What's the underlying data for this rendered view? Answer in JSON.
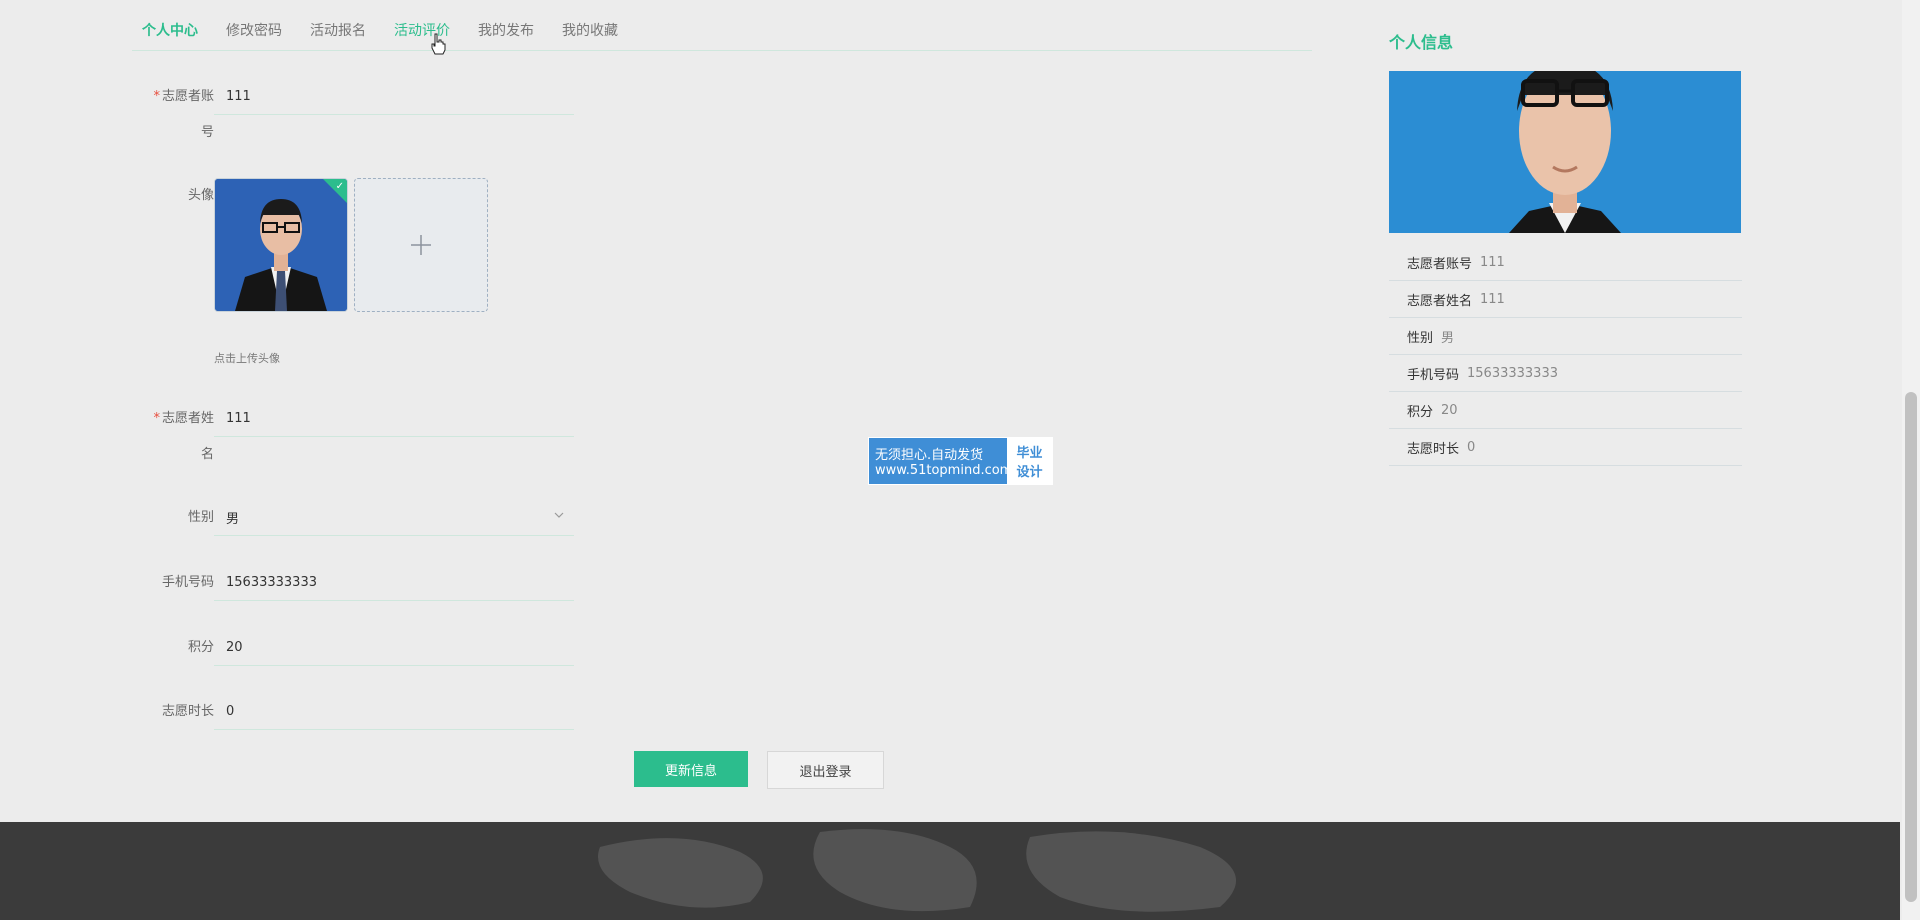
{
  "tabs": [
    {
      "label": "个人中心"
    },
    {
      "label": "修改密码"
    },
    {
      "label": "活动报名"
    },
    {
      "label": "活动评价"
    },
    {
      "label": "我的发布"
    },
    {
      "label": "我的收藏"
    }
  ],
  "form": {
    "account_label": "志愿者账号",
    "account_value": "111",
    "avatar_label": "头像",
    "upload_hint": "点击上传头像",
    "name_label": "志愿者姓名",
    "name_value": "111",
    "gender_label": "性别",
    "gender_value": "男",
    "phone_label": "手机号码",
    "phone_value": "15633333333",
    "points_label": "积分",
    "points_value": "20",
    "hours_label": "志愿时长",
    "hours_value": "0",
    "required_mark": "*"
  },
  "buttons": {
    "update": "更新信息",
    "logout": "退出登录"
  },
  "watermark": {
    "line1": "无须担心.自动发货",
    "line2": "www.51topmind.com",
    "right1": "毕业",
    "right2": "设计"
  },
  "profile": {
    "title": "个人信息",
    "rows": [
      {
        "label": "志愿者账号",
        "value": "111"
      },
      {
        "label": "志愿者姓名",
        "value": "111"
      },
      {
        "label": "性别",
        "value": "男"
      },
      {
        "label": "手机号码",
        "value": "15633333333"
      },
      {
        "label": "积分",
        "value": "20"
      },
      {
        "label": "志愿时长",
        "value": "0"
      }
    ]
  },
  "colors": {
    "accent": "#2cbd8d",
    "footer": "#3b3b3b",
    "background": "#ececec"
  }
}
